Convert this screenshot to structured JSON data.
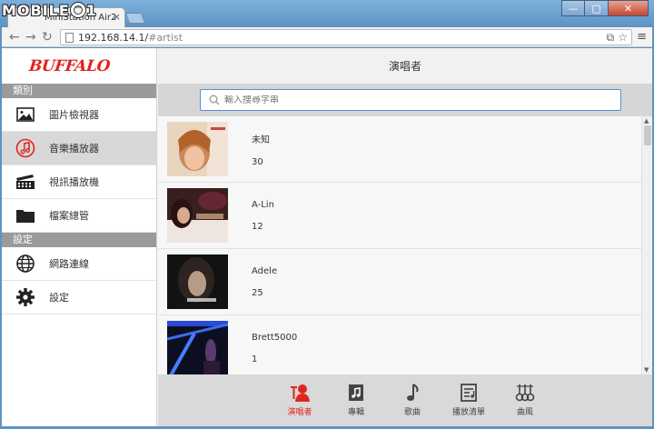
{
  "browser": {
    "watermark": "MOBILE01",
    "tab_title": "MiniStation Air2",
    "tab_close": "×",
    "url_host": "192.168.14.1/",
    "url_path": "#artist",
    "window_buttons": [
      "—",
      "▢",
      "✕"
    ]
  },
  "app": {
    "brand": "BUFFALO",
    "header_title": "演唱者",
    "search": {
      "placeholder": "輸入搜尋字串"
    },
    "sidebar": {
      "section_categories": "類別",
      "section_settings": "設定",
      "items": [
        {
          "label": "圖片檢視器",
          "icon": "image-icon"
        },
        {
          "label": "音樂播放器",
          "icon": "music-note-icon",
          "active": true
        },
        {
          "label": "視訊播放機",
          "icon": "film-icon"
        },
        {
          "label": "檔案總管",
          "icon": "folder-icon"
        }
      ],
      "settings_items": [
        {
          "label": "網路連線",
          "icon": "globe-icon"
        },
        {
          "label": "設定",
          "icon": "gear-icon"
        }
      ]
    },
    "artists": [
      {
        "name": "未知",
        "count": "30"
      },
      {
        "name": "A-Lin",
        "count": "12"
      },
      {
        "name": "Adele",
        "count": "25"
      },
      {
        "name": "Brett5000",
        "count": "1"
      }
    ],
    "bottom_nav": [
      {
        "label": "演唱者",
        "icon": "artist-icon",
        "active": true
      },
      {
        "label": "專輯",
        "icon": "album-icon"
      },
      {
        "label": "歌曲",
        "icon": "song-icon"
      },
      {
        "label": "播放清單",
        "icon": "playlist-icon"
      },
      {
        "label": "曲風",
        "icon": "genre-icon"
      }
    ],
    "colors": {
      "brand_red": "#e1211e",
      "active_red": "#e02520",
      "search_border": "#4d90d6"
    }
  }
}
